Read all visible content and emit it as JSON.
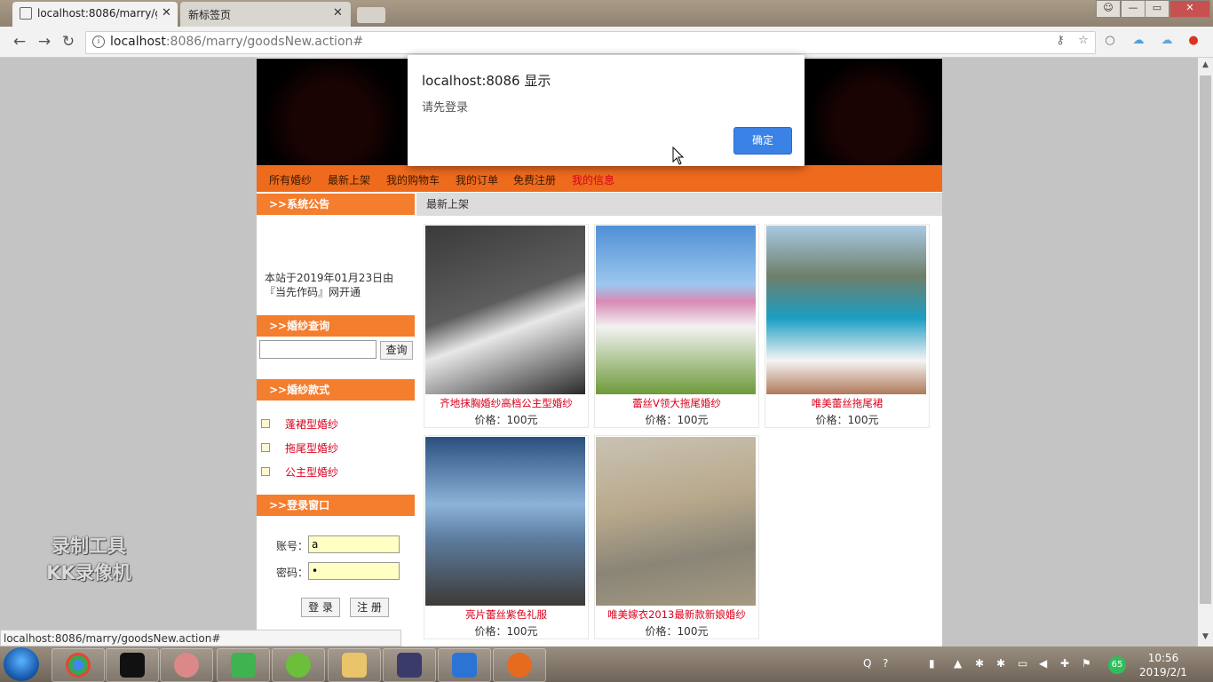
{
  "browser": {
    "tabs": [
      {
        "title": "localhost:8086/marry/g",
        "close": "✕"
      },
      {
        "title": "新标签页",
        "close": "✕"
      }
    ],
    "url_host": "localhost",
    "url_rest": ":8086/marry/goodsNew.action#",
    "window_buttons": [
      "—",
      "▭",
      "✕"
    ]
  },
  "site": {
    "nav": [
      "所有婚纱",
      "最新上架",
      "我的购物车",
      "我的订单",
      "免费注册",
      "我的信息"
    ],
    "active_nav_color": "#d9001b",
    "sidebar": {
      "notice_title": ">>系统公告",
      "notice_text": "本站于2019年01月23日由『当先作码』网开通",
      "search_title": ">>婚纱查询",
      "search_button": "查询",
      "styles_title": ">>婚纱款式",
      "styles": [
        "蓬裙型婚纱",
        "拖尾型婚纱",
        "公主型婚纱"
      ],
      "login_title": ">>登录窗口",
      "account_label": "账号：",
      "account_value": "a",
      "password_label": "密码：",
      "password_value": "•",
      "login_button": "登 录",
      "register_button": "注 册"
    },
    "main_title": "最新上架",
    "goods": [
      {
        "name": "齐地抹胸婚纱高档公主型婚纱",
        "price": "价格：100元"
      },
      {
        "name": "蕾丝V领大拖尾婚纱",
        "price": "价格：100元"
      },
      {
        "name": "唯美蕾丝拖尾裙",
        "price": "价格：100元"
      },
      {
        "name": "亮片蕾丝紫色礼服",
        "price": "价格：100元"
      },
      {
        "name": "唯美嫁衣2013最新款新娘婚纱",
        "price": "价格：100元"
      }
    ]
  },
  "dialog": {
    "title": "localhost:8086 显示",
    "message": "请先登录",
    "ok": "确定"
  },
  "status_url": "localhost:8086/marry/goodsNew.action#",
  "watermark": [
    "录制工具",
    "KK录像机"
  ],
  "taskbar": {
    "clock_time": "10:56",
    "clock_date": "2019/2/1",
    "badge": "65"
  }
}
